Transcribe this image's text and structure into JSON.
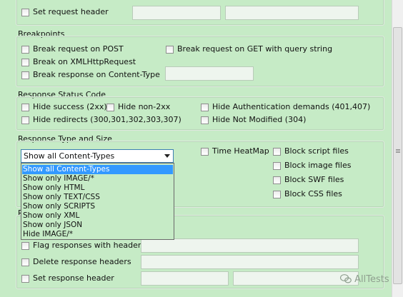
{
  "top_section": {
    "set_request_header_label": "Set request header",
    "fields": [
      {
        "value": ""
      },
      {
        "value": ""
      }
    ]
  },
  "breakpoints": {
    "title": "Breakpoints",
    "break_post": "Break request on POST",
    "break_get": "Break request on GET with query string",
    "break_xhr": "Break on XMLHttpRequest",
    "break_response_content_type": "Break response on Content-Type",
    "content_type_value": ""
  },
  "response_status_code": {
    "title": "Response Status Code",
    "hide_success": "Hide success (2xx)",
    "hide_non_2xx": "Hide non-2xx",
    "hide_auth": "Hide Authentication demands (401,407)",
    "hide_redirects": "Hide redirects (300,301,302,303,307)",
    "hide_not_modified": "Hide Not Modified (304)"
  },
  "response_type": {
    "title": "Response Type and Size",
    "selected": "Show all Content-Types",
    "options": [
      "Show all Content-Types",
      "Show only IMAGE/*",
      "Show only HTML",
      "Show only TEXT/CSS",
      "Show only SCRIPTS",
      "Show only XML",
      "Show only JSON",
      "Hide IMAGE/*"
    ],
    "time_heatmap": "Time HeatMap",
    "block_script": "Block script files",
    "block_image": "Block image files",
    "block_swf": "Block SWF files",
    "block_css": "Block CSS files"
  },
  "response_headers": {
    "title_initial": "R",
    "flag_with_headers": "Flag responses with headers",
    "delete_headers": "Delete response headers",
    "set_header": "Set response header",
    "fields": [
      {
        "value": ""
      },
      {
        "value": ""
      },
      {
        "value": ""
      },
      {
        "value": ""
      }
    ]
  },
  "watermark": {
    "text": "AllTests"
  },
  "icons": {
    "combo_arrow": "chevron-down-icon",
    "watermark_icon": "wechat-icon",
    "scroll_grip": "grip-icon"
  },
  "colors": {
    "background": "#c6ebc6",
    "selection": "#3399ff",
    "combo_border": "#3c7fb1"
  }
}
